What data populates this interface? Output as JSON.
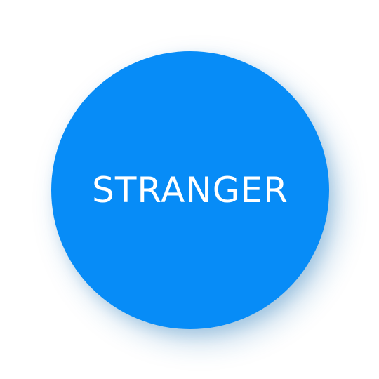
{
  "button": {
    "label": "STRANGER",
    "background_color": "#078cf7",
    "text_color": "#ffffff"
  },
  "page": {
    "background_color": "#ffffff"
  }
}
